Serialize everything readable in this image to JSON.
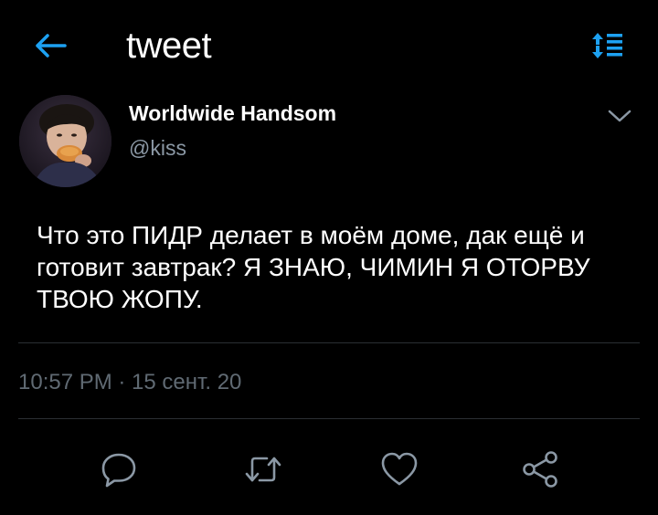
{
  "header": {
    "title": "tweet",
    "back_icon": "arrow-left-icon",
    "sort_icon": "sort-list-icon",
    "accent_color": "#1da1f2"
  },
  "tweet": {
    "author": {
      "display_name": "Worldwide Handsom",
      "handle": "@kiss"
    },
    "text": "Что это ПИДР делает в моём доме, дак ещё и готовит завтрак? Я ЗНАЮ, ЧИМИН Я ОТОРВУ ТВОЮ ЖОПУ.",
    "timestamp": "10:57 PM · 15 сент. 20",
    "more_icon": "chevron-down-icon"
  },
  "actions": [
    {
      "name": "reply",
      "icon": "reply-bubble-icon"
    },
    {
      "name": "retweet",
      "icon": "retweet-icon"
    },
    {
      "name": "like",
      "icon": "heart-icon"
    },
    {
      "name": "share",
      "icon": "share-icon"
    }
  ],
  "colors": {
    "background": "#000000",
    "text_primary": "#ffffff",
    "text_secondary": "#8b98a5",
    "text_muted": "#606a73",
    "divider": "#2b2f33",
    "icon": "#8b98a5"
  }
}
